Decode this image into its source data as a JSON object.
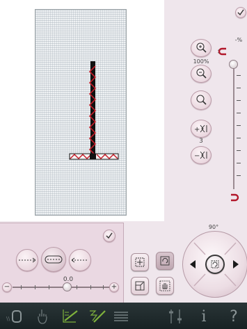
{
  "zoom": {
    "level_label": "100%"
  },
  "scale": {
    "percent_label": "-%"
  },
  "repeat": {
    "count_label": "3"
  },
  "spacing": {
    "value_label": "0.0"
  },
  "rotation": {
    "angle_label": "90°"
  },
  "colors": {
    "pink_panel": "#efe6ec",
    "left_panel": "#ffffff",
    "bottom_panel": "#ead8e2",
    "taskbar": "#1f2b2d",
    "taskbar_active": "#7fb23c"
  },
  "taskbar": {
    "items": [
      "embroidery-machine-icon",
      "touch-icon",
      "stitch-program-icon",
      "stitch-edit-icon",
      "sequence-icon",
      "settings-icon",
      "info-icon",
      "help-icon"
    ],
    "info_label": "i",
    "help_label": "?"
  }
}
